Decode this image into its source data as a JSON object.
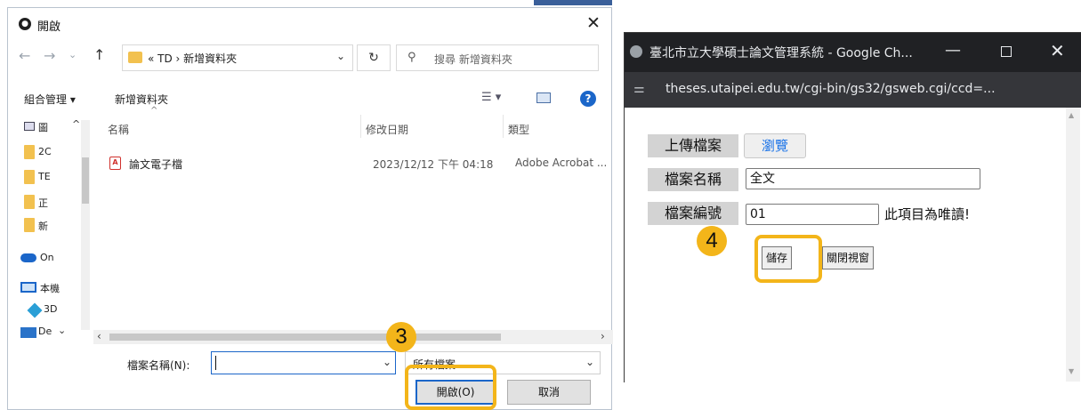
{
  "open_dialog": {
    "title": "開啟",
    "path": "« TD › 新增資料夾",
    "search_placeholder": "搜尋 新增資料夾",
    "organize": "組合管理 ▾",
    "new_folder": "新增資料夾",
    "columns": {
      "name": "名稱",
      "modified": "修改日期",
      "type": "類型"
    },
    "nav_items": [
      "圖",
      "2C",
      "TE",
      "正",
      "新",
      "On",
      "本機",
      "3D",
      "De"
    ],
    "files": [
      {
        "name": "論文電子檔",
        "modified": "2023/12/12 下午 04:18",
        "type": "Adobe Acrobat ..."
      }
    ],
    "filename_label": "檔案名稱(N):",
    "filename_value": "",
    "filetype_selected": "所有檔案",
    "open_button": "開啟(O)",
    "cancel_button": "取消",
    "step_marker": "3"
  },
  "chrome_popup": {
    "title": "臺北市立大學碩士論文管理系統 - Google Ch...",
    "url": "theses.utaipei.edu.tw/cgi-bin/gs32/gsweb.cgi/ccd=...",
    "upload_label": "上傳檔案",
    "browse_button": "瀏覽",
    "file_name_label": "檔案名稱",
    "file_name_value": "全文",
    "file_no_label": "檔案編號",
    "file_no_value": "01",
    "readonly_note": "此項目為唯讀!",
    "save_button": "儲存",
    "close_button": "關閉視窗",
    "step_marker": "4"
  },
  "colors": {
    "highlight": "#f3b51a",
    "accent": "#1b66c9"
  },
  "icons": [
    "back-arrow-icon",
    "forward-arrow-icon",
    "up-arrow-icon",
    "refresh-icon",
    "search-icon",
    "help-icon",
    "pdf-icon",
    "folder-icon",
    "onedrive-icon",
    "pc-icon"
  ]
}
